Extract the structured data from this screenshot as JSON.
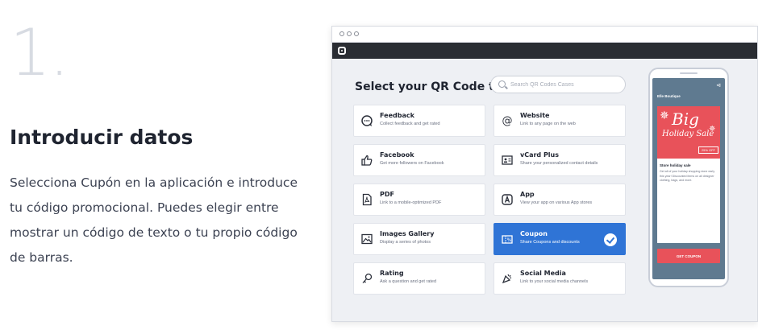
{
  "intro": {
    "step_number": "1.",
    "title": "Introducir datos",
    "description": "Selecciona Cupón en la aplicación e introduce tu código promocional. Puedes elegir entre mostrar un código de texto o tu propio código de barras."
  },
  "app": {
    "heading": "Select your QR Code type",
    "search": {
      "placeholder": "Search QR Codes Cases"
    },
    "cards": [
      {
        "title": "Feedback",
        "subtitle": "Collect feedback and get rated",
        "icon": "feedback-icon"
      },
      {
        "title": "Website",
        "subtitle": "Link to any page on the web",
        "icon": "at-sign-icon"
      },
      {
        "title": "Facebook",
        "subtitle": "Get more followers on Facebook",
        "icon": "thumbs-up-icon"
      },
      {
        "title": "vCard Plus",
        "subtitle": "Share your personalized contact details",
        "icon": "contact-card-icon"
      },
      {
        "title": "PDF",
        "subtitle": "Link to a mobile-optimized PDF",
        "icon": "pdf-icon"
      },
      {
        "title": "App",
        "subtitle": "View your app on various App stores",
        "icon": "app-store-icon"
      },
      {
        "title": "Images Gallery",
        "subtitle": "Display a series of photos",
        "icon": "image-icon"
      },
      {
        "title": "Coupon",
        "subtitle": "Share Coupons and discounts",
        "icon": "coupon-icon",
        "selected": true
      },
      {
        "title": "Rating",
        "subtitle": "Ask a question and get rated",
        "icon": "rating-icon"
      },
      {
        "title": "Social Media",
        "subtitle": "Link to your social media channels",
        "icon": "social-media-icon"
      }
    ]
  },
  "preview": {
    "store_name": "Elle Boutique",
    "banner_big": "Big",
    "banner_line": "Holiday Sale",
    "discount": "25% OFF",
    "headline": "Store holiday sale",
    "description": "Get all of your holiday shopping done early this year! Discounted items on all designer clothing, bags, and more.",
    "button_label": "GET COUPON"
  },
  "colors": {
    "accent": "#2f74d6",
    "coupon_red": "#e8525a",
    "phone_bg": "#5f7a90",
    "navbar": "#2a2d33"
  }
}
